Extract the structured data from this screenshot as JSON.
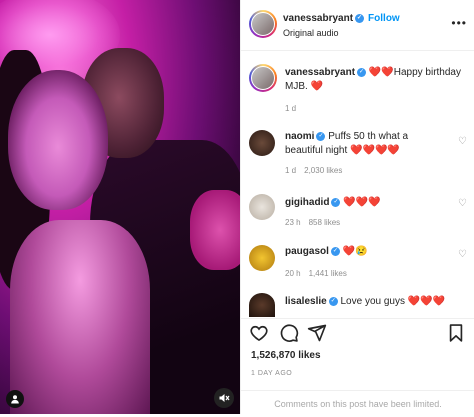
{
  "header": {
    "username": "vanessabryant",
    "follow_label": "Follow",
    "audio_label": "Original audio"
  },
  "caption": {
    "username": "vanessabryant",
    "text": "Happy birthday MJB.",
    "time": "1 d"
  },
  "comments": [
    {
      "username": "naomi",
      "text": "Puffs 50 th what a beautiful night",
      "emoji": "❤️❤️❤️❤️",
      "time": "1 d",
      "likes": "2,030 likes"
    },
    {
      "username": "gigihadid",
      "text": "",
      "emoji": "❤️❤️❤️",
      "time": "23 h",
      "likes": "858 likes"
    },
    {
      "username": "paugasol",
      "text": "",
      "emoji": "❤️😢",
      "time": "20 h",
      "likes": "1,441 likes"
    },
    {
      "username": "lisaleslie",
      "text": "Love you guys",
      "emoji": "❤️❤️❤️",
      "time": "",
      "likes": ""
    }
  ],
  "post": {
    "likes": "1,526,870 likes",
    "age": "1 DAY AGO",
    "comments_limited": "Comments on this post have been limited."
  },
  "icons": {
    "verified": "verified-badge-icon",
    "more": "more-options-icon",
    "like": "heart-icon",
    "comment": "comment-icon",
    "share": "share-icon",
    "save": "bookmark-icon",
    "tagged": "person-tag-icon",
    "mute": "muted-speaker-icon"
  },
  "colors": {
    "accent": "#0095f6",
    "verified": "#3897f0",
    "heart": "#e0245e"
  }
}
